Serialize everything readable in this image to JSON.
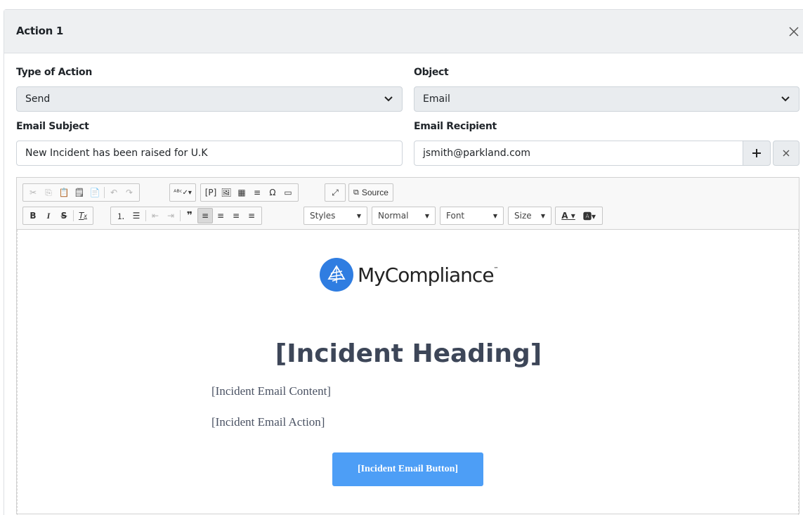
{
  "modal": {
    "title": "Action 1"
  },
  "form": {
    "type_of_action": {
      "label": "Type of Action",
      "value": "Send"
    },
    "object": {
      "label": "Object",
      "value": "Email"
    },
    "email_subject": {
      "label": "Email Subject",
      "value": "New Incident has been raised for U.K"
    },
    "email_recipient": {
      "label": "Email Recipient",
      "value": "jsmith@parkland.com"
    }
  },
  "editor": {
    "toolbar": {
      "source_label": "Source",
      "styles_label": "Styles",
      "format_label": "Normal",
      "font_label": "Font",
      "size_label": "Size"
    },
    "content": {
      "logo_text": "MyCompliance",
      "logo_tm": "™",
      "heading": "[Incident Heading]",
      "email_content": "[Incident Email Content]",
      "email_action": "[Incident Email Action]",
      "button_label": "[Incident Email Button]"
    }
  },
  "colors": {
    "accent_button": "#4d9ef6",
    "heading": "#3d4658",
    "logo_circle": "#2f7de1"
  }
}
